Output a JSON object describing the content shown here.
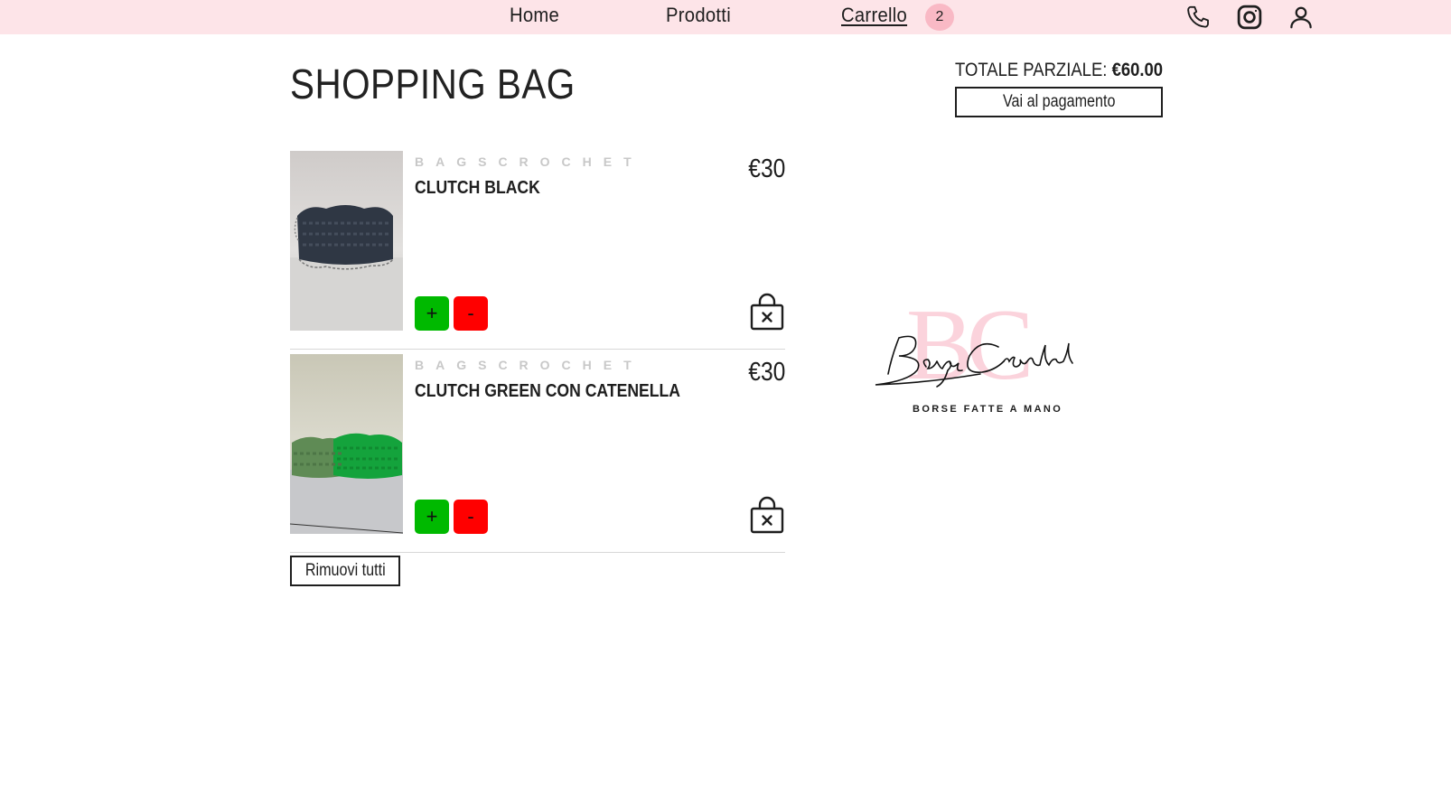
{
  "nav": {
    "home": "Home",
    "products": "Prodotti",
    "cart": "Carrello",
    "cart_count": "2",
    "icons": [
      "phone-icon",
      "instagram-icon",
      "user-icon"
    ]
  },
  "page": {
    "title": "SHOPPING BAG"
  },
  "summary": {
    "subtotal_label": "TOTALE PARZIALE:",
    "subtotal_value": "€60.00",
    "checkout_label": "Vai al pagamento"
  },
  "cart": {
    "items": [
      {
        "brand": "BAGSCROCHET",
        "name": "CLUTCH BLACK",
        "price": "€30",
        "plus": "+",
        "minus": "-",
        "image": "black-crochet-clutch"
      },
      {
        "brand": "BAGSCROCHET",
        "name": "CLUTCH GREEN CON CATENELLA",
        "price": "€30",
        "plus": "+",
        "minus": "-",
        "image": "green-crochet-clutches"
      }
    ],
    "remove_all_label": "Rimuovi tutti"
  },
  "logo": {
    "monogram": "BC",
    "script": "BagsCrochet",
    "tagline": "BORSE FATTE A MANO"
  },
  "colors": {
    "nav_bg": "#fde4e8",
    "badge_bg": "#f9b9c5",
    "plus_bg": "#00b900",
    "minus_bg": "#ff0000",
    "logo_pink": "#fbd3dc"
  }
}
